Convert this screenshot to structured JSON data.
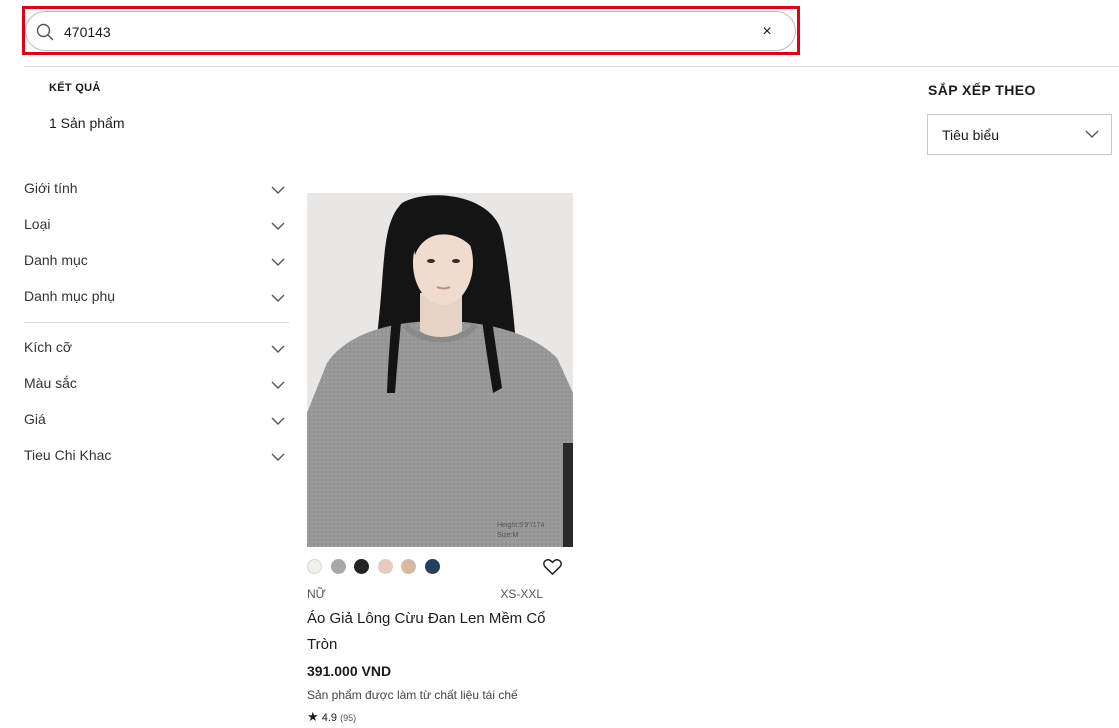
{
  "search": {
    "value": "470143",
    "placeholder": "",
    "clear_label": "×"
  },
  "results": {
    "heading": "KẾT QUẢ",
    "count": "1 Sản phẩm"
  },
  "sort": {
    "heading": "SẮP XẾP THEO",
    "selected": "Tiêu biểu"
  },
  "filters": {
    "group1": [
      "Giới tính",
      "Loại",
      "Danh mục",
      "Danh mục phụ"
    ],
    "group2": [
      "Kích cỡ",
      "Màu sắc",
      "Giá",
      "Tieu Chi Khac"
    ]
  },
  "product": {
    "image_caption_line1": "Height:5'9\"/174",
    "image_caption_line2": "Size:M",
    "swatch_colors": [
      "#f1efe9",
      "#a8a8a8",
      "#232323",
      "#e8c9c2",
      "#d6b9a0",
      "#24405f"
    ],
    "gender": "NỮ",
    "sizes": "XS-XXL",
    "name": "Áo Giả Lông Cừu Đan Len Mềm Cổ Tròn",
    "price": "391.000 VND",
    "note": "Sản phẩm được làm từ chất liệu tái chế",
    "rating_star": "★",
    "rating_value": "4.9",
    "rating_count": "(95)"
  },
  "colors": {
    "highlight": "#e0001b",
    "divider": "#dadada"
  }
}
